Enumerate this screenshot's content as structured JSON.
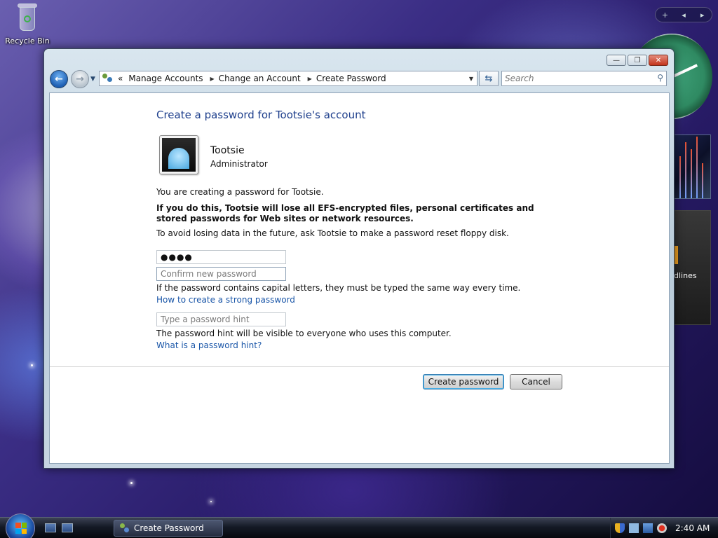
{
  "desktop": {
    "recycle_bin_label": "Recycle Bin",
    "sidebar_control_add": "+",
    "sidebar_control_prev": "◂",
    "sidebar_control_next": "▸",
    "news_gadget_text": "dlines"
  },
  "window": {
    "minimize": "—",
    "maximize": "❐",
    "close": "✕",
    "breadcrumb": {
      "prefix": "«",
      "items": [
        "Manage Accounts",
        "Change an Account",
        "Create Password"
      ]
    },
    "search": {
      "placeholder": "Search"
    },
    "content": {
      "title": "Create a password for Tootsie's account",
      "user": {
        "name": "Tootsie",
        "role": "Administrator"
      },
      "intro": "You are creating a password for Tootsie.",
      "warning": "If you do this, Tootsie will lose all EFS-encrypted files, personal certificates and stored passwords for Web sites or network resources.",
      "advice": "To avoid losing data in the future, ask Tootsie to make a password reset floppy disk.",
      "new_password": {
        "value": "●●●●"
      },
      "confirm_password": {
        "placeholder": "Confirm new password",
        "value": ""
      },
      "caps_note": "If the password contains capital letters, they must be typed the same way every time.",
      "strong_link": "How to create a strong password",
      "hint": {
        "placeholder": "Type a password hint",
        "value": ""
      },
      "hint_note": "The password hint will be visible to everyone who uses this computer.",
      "hint_link": "What is a password hint?",
      "create_button": "Create password",
      "cancel_button": "Cancel"
    }
  },
  "taskbar": {
    "active_task": "Create Password",
    "time": "2:40 AM"
  }
}
